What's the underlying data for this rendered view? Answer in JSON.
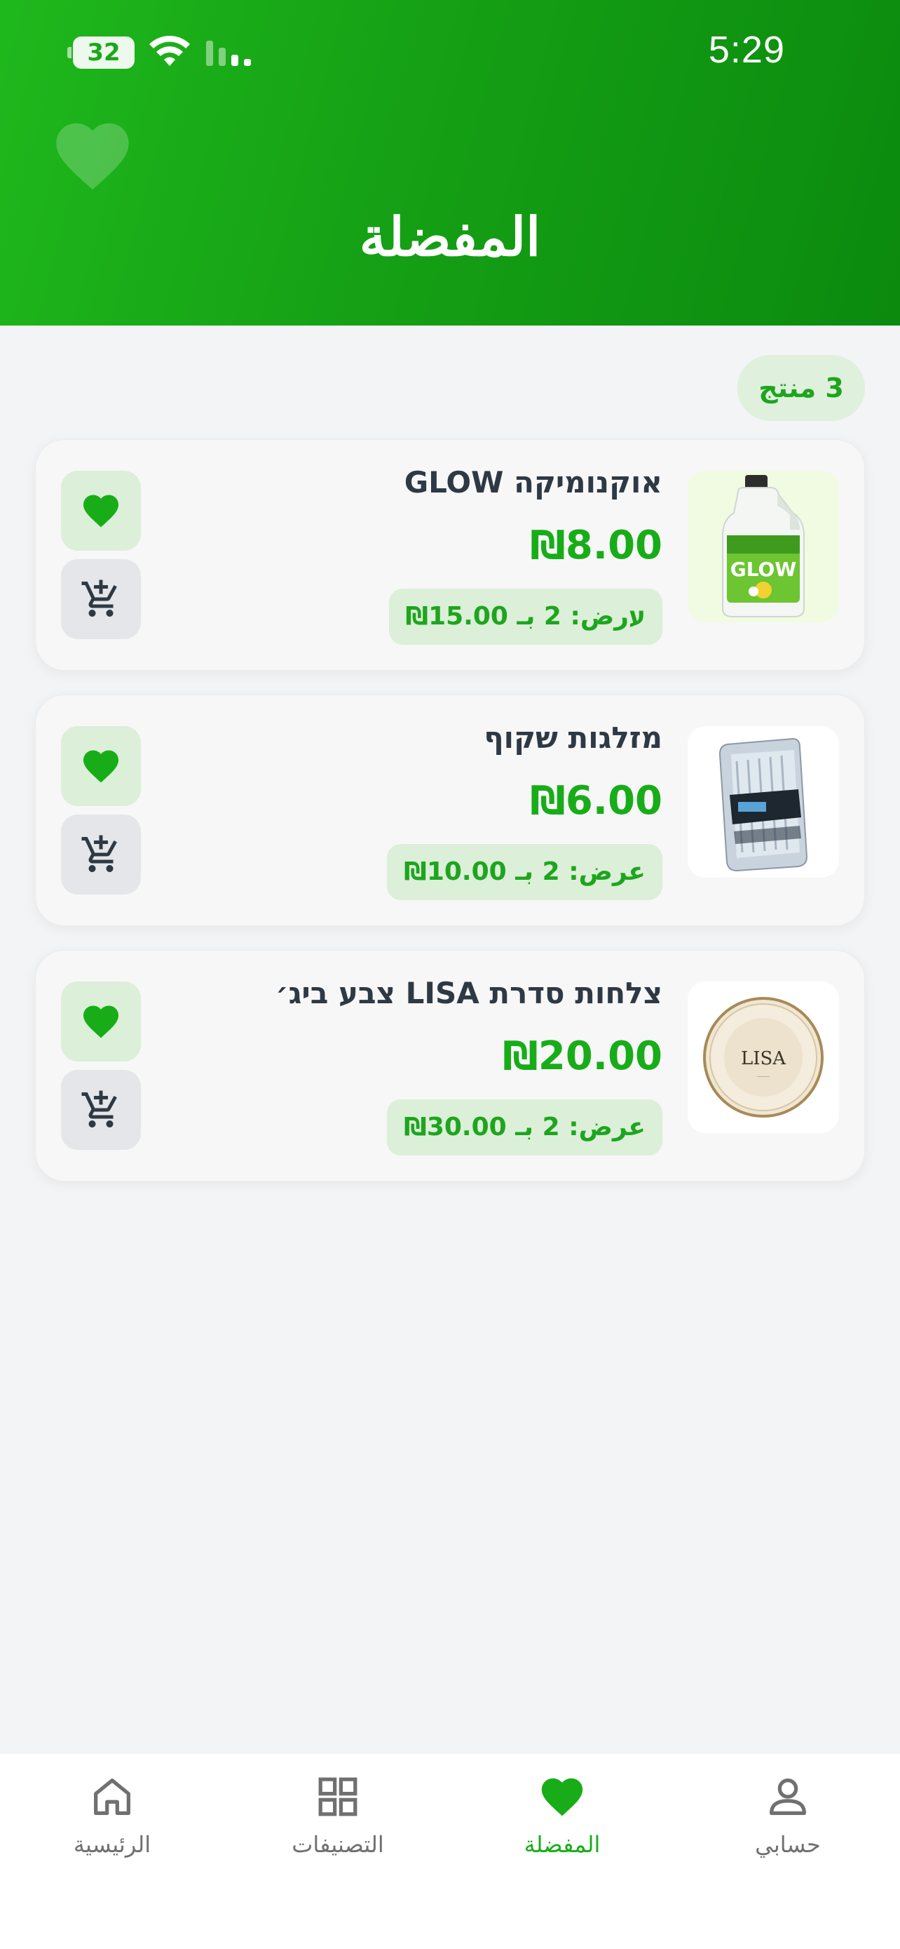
{
  "status_bar": {
    "battery": "32",
    "time": "5:29"
  },
  "header": {
    "title": "المفضلة",
    "icon": "heart-icon"
  },
  "count_badge": "3 منتج",
  "products": [
    {
      "title": "אוקנומיקה GLOW",
      "price": "₪8.00",
      "offer": "עرض: 2 بـ 15.00₪",
      "image_icon": "bleach-bottle-image",
      "favorited": true
    },
    {
      "title": "מזלגות שקוף",
      "price": "₪6.00",
      "offer": "عرض: 2 بـ 10.00₪",
      "image_icon": "plastic-forks-image",
      "favorited": true
    },
    {
      "title": "צלחות סדרת LISA צבע ביג׳",
      "price": "₪20.00",
      "offer": "عرض: 2 بـ 30.00₪",
      "image_icon": "lisa-plate-image",
      "favorited": true
    }
  ],
  "nav": {
    "items": [
      {
        "label": "الرئيسية",
        "icon": "home-icon"
      },
      {
        "label": "التصنيفات",
        "icon": "grid-icon"
      },
      {
        "label": "المفضلة",
        "icon": "heart-icon",
        "active": true
      },
      {
        "label": "حسابي",
        "icon": "user-icon"
      }
    ]
  },
  "colors": {
    "brand_green": "#18ad18",
    "header_start": "#1fb81c",
    "header_end": "#0b8a0e",
    "text_dark": "#2e3944",
    "badge_bg": "#dcefd8",
    "page_bg": "#f3f4f6"
  }
}
